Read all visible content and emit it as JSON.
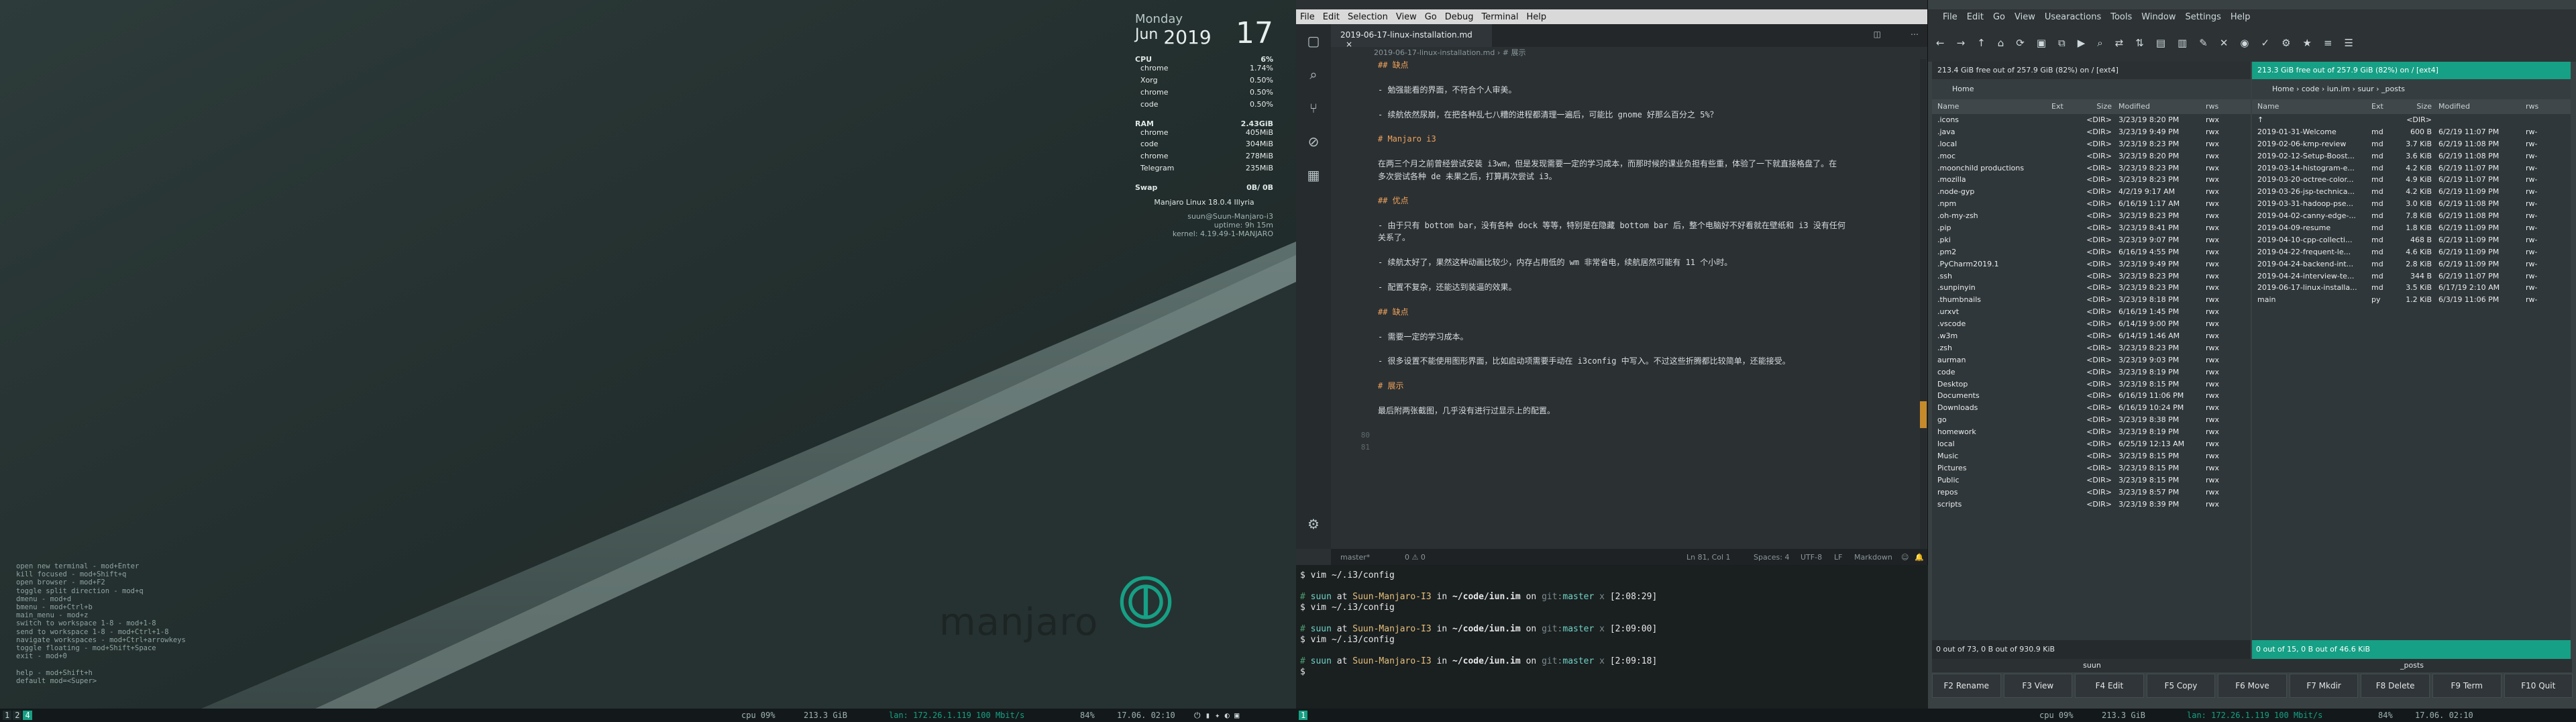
{
  "desktop": {
    "clock": {
      "day_name": "Monday",
      "month": "Jun",
      "year": "2019",
      "day": "17"
    },
    "cpu": {
      "label": "CPU",
      "value": "6%",
      "procs": [
        [
          "chrome",
          "1.74%"
        ],
        [
          "Xorg",
          "0.50%"
        ],
        [
          "chrome",
          "0.50%"
        ],
        [
          "code",
          "0.50%"
        ]
      ]
    },
    "ram": {
      "label": "RAM",
      "value": "2.43GiB",
      "procs": [
        [
          "chrome",
          "405MiB"
        ],
        [
          "code",
          "304MiB"
        ],
        [
          "chrome",
          "278MiB"
        ],
        [
          "Telegram",
          "235MiB"
        ]
      ]
    },
    "swap": {
      "label": "Swap",
      "value": "0B/ 0B"
    },
    "sys": {
      "os": "Manjaro Linux 18.0.4 Illyria",
      "user": "suun@Suun-Manjaro-i3",
      "uptime": "uptime: 9h 15m",
      "kernel": "kernel: 4.19.49-1-MANJARO"
    },
    "logo_text": "manjaro",
    "hints": [
      "open new terminal - mod+Enter",
      "kill focused - mod+Shift+q",
      "open browser - mod+F2",
      "toggle split direction - mod+q",
      "dmenu - mod+d",
      "bmenu - mod+Ctrl+b",
      "main_menu - mod+z",
      "switch to workspace 1-8 - mod+1-8",
      "send to workspace 1-8 - mod+Ctrl+1-8",
      "navigate workspaces - mod+Ctrl+arrowkeys",
      "toggle floating - mod+Shift+Space",
      "exit - mod+0",
      "",
      "help - mod+Shift+h",
      "default mod=<Super>"
    ]
  },
  "statusbar": {
    "ws_left": [
      "1",
      "2",
      "4"
    ],
    "cpu": "cpu  09%",
    "disk": "213.3 GiB",
    "lan": "lan: 172.26.1.119 100 Mbit/s",
    "bat": "84%",
    "datetime": "17.06. 02:10",
    "ws_right": [
      "1"
    ],
    "cpu2": "cpu  09%",
    "disk2": "213.3 GiB",
    "lan2": "lan: 172.26.1.119 100 Mbit/s",
    "bat2": "84%",
    "datetime2": "17.06. 02:10"
  },
  "editor": {
    "menu": [
      "File",
      "Edit",
      "Selection",
      "View",
      "Go",
      "Debug",
      "Terminal",
      "Help"
    ],
    "tab": "2019-06-17-linux-installation.md",
    "breadcrumb": "2019-06-17-linux-installation.md › # 展示",
    "lines": [
      {
        "n": "",
        "t": "## 缺点",
        "k": "h"
      },
      {
        "n": "",
        "t": "",
        "k": "l"
      },
      {
        "n": "",
        "t": "- 勉强能看的界面，不符合个人审美。",
        "k": "l"
      },
      {
        "n": "",
        "t": "",
        "k": "l"
      },
      {
        "n": "",
        "t": "- 续航依然尿崩，在把各种乱七八糟的进程都清理一遍后，可能比 gnome 好那么百分之 5%？",
        "k": "l"
      },
      {
        "n": "",
        "t": "",
        "k": "l"
      },
      {
        "n": "",
        "t": "# Manjaro i3",
        "k": "h"
      },
      {
        "n": "",
        "t": "",
        "k": "l"
      },
      {
        "n": "",
        "t": "在两三个月之前曾经尝试安装 i3wm，但是发现需要一定的学习成本，而那时候的课业负担有些重，体验了一下就直接格盘了。在",
        "k": "l"
      },
      {
        "n": "",
        "t": "多次尝试各种 de 未果之后，打算再次尝试 i3。",
        "k": "l"
      },
      {
        "n": "",
        "t": "",
        "k": "l"
      },
      {
        "n": "",
        "t": "## 优点",
        "k": "h"
      },
      {
        "n": "",
        "t": "",
        "k": "l"
      },
      {
        "n": "",
        "t": "- 由于只有 bottom bar，没有各种 dock 等等，特别是在隐藏 bottom bar 后，整个电脑好不好看就在壁纸和 i3 没有任何",
        "k": "l"
      },
      {
        "n": "",
        "t": "关系了。",
        "k": "l"
      },
      {
        "n": "",
        "t": "",
        "k": "l"
      },
      {
        "n": "",
        "t": "- 续航太好了，果然这种动画比较少，内存占用低的 wm 非常省电，续航居然可能有 11 个小时。",
        "k": "l"
      },
      {
        "n": "",
        "t": "",
        "k": "l"
      },
      {
        "n": "",
        "t": "- 配置不复杂，还能达到装逼的效果。",
        "k": "l"
      },
      {
        "n": "",
        "t": "",
        "k": "l"
      },
      {
        "n": "",
        "t": "## 缺点",
        "k": "h"
      },
      {
        "n": "",
        "t": "",
        "k": "l"
      },
      {
        "n": "",
        "t": "- 需要一定的学习成本。",
        "k": "l"
      },
      {
        "n": "",
        "t": "",
        "k": "l"
      },
      {
        "n": "",
        "t": "- 很多设置不能使用图形界面，比如启动项需要手动在 i3config 中写入。不过这些折腾都比较简单，还能接受。",
        "k": "l"
      },
      {
        "n": "",
        "t": "",
        "k": "l"
      },
      {
        "n": "",
        "t": "# 展示",
        "k": "h"
      },
      {
        "n": "",
        "t": "",
        "k": "l"
      },
      {
        "n": "",
        "t": "最后附两张截图，几乎没有进行过显示上的配置。",
        "k": "l"
      },
      {
        "n": "",
        "t": "",
        "k": "l"
      },
      {
        "n": "80",
        "t": "",
        "k": "l"
      },
      {
        "n": "81",
        "t": "",
        "k": "l"
      }
    ],
    "status": {
      "branch": "master*",
      "errors": "0 ⚠ 0",
      "pos": "Ln 81, Col 1",
      "spaces": "Spaces: 4",
      "enc": "UTF-8",
      "eol": "LF",
      "lang": "Markdown"
    }
  },
  "terminal": {
    "lines": [
      {
        "type": "cmd",
        "text": "$ vim ~/.i3/config"
      },
      {
        "type": "blank"
      },
      {
        "type": "prompt",
        "user": "suun",
        "host": "Suun-Manjaro-I3",
        "dir": "~/code/iun.im",
        "branch": "master",
        "time": "[2:08:29]"
      },
      {
        "type": "cmd",
        "text": "$ vim ~/.i3/config"
      },
      {
        "type": "blank"
      },
      {
        "type": "prompt",
        "user": "suun",
        "host": "Suun-Manjaro-I3",
        "dir": "~/code/iun.im",
        "branch": "master",
        "time": "[2:09:00]"
      },
      {
        "type": "cmd",
        "text": "$ vim ~/.i3/config"
      },
      {
        "type": "blank"
      },
      {
        "type": "prompt",
        "user": "suun",
        "host": "Suun-Manjaro-I3",
        "dir": "~/code/iun.im",
        "branch": "master",
        "time": "[2:09:18]"
      },
      {
        "type": "cmd",
        "text": "$ "
      }
    ]
  },
  "filemanager": {
    "menu": [
      "File",
      "Edit",
      "Go",
      "View",
      "Usearactions",
      "Tools",
      "Window",
      "Settings",
      "Help"
    ],
    "left": {
      "drive": "213.4 GiB free out of 257.9 GiB (82%) on / [ext4]",
      "path": "Home",
      "cols": [
        "Name",
        "Ext",
        "Size",
        "Modified",
        "rws"
      ],
      "rows": [
        [
          ".icons",
          "",
          "<DIR>",
          "3/23/19 8:20 PM",
          "rwx"
        ],
        [
          ".java",
          "",
          "<DIR>",
          "3/23/19 9:49 PM",
          "rwx"
        ],
        [
          ".local",
          "",
          "<DIR>",
          "3/23/19 8:23 PM",
          "rwx"
        ],
        [
          ".moc",
          "",
          "<DIR>",
          "3/23/19 8:20 PM",
          "rwx"
        ],
        [
          ".moonchild productions",
          "",
          "<DIR>",
          "3/23/19 8:23 PM",
          "rwx"
        ],
        [
          ".mozilla",
          "",
          "<DIR>",
          "3/23/19 8:23 PM",
          "rwx"
        ],
        [
          ".node-gyp",
          "",
          "<DIR>",
          "4/2/19 9:17 AM",
          "rwx"
        ],
        [
          ".npm",
          "",
          "<DIR>",
          "6/16/19 1:17 AM",
          "rwx"
        ],
        [
          ".oh-my-zsh",
          "",
          "<DIR>",
          "3/23/19 8:23 PM",
          "rwx"
        ],
        [
          ".pip",
          "",
          "<DIR>",
          "3/23/19 8:41 PM",
          "rwx"
        ],
        [
          ".pki",
          "",
          "<DIR>",
          "3/23/19 9:07 PM",
          "rwx"
        ],
        [
          ".pm2",
          "",
          "<DIR>",
          "6/16/19 4:55 PM",
          "rwx"
        ],
        [
          ".PyCharm2019.1",
          "",
          "<DIR>",
          "3/23/19 9:49 PM",
          "rwx"
        ],
        [
          ".ssh",
          "",
          "<DIR>",
          "3/23/19 8:23 PM",
          "rwx"
        ],
        [
          ".sunpinyin",
          "",
          "<DIR>",
          "3/23/19 8:23 PM",
          "rwx"
        ],
        [
          ".thumbnails",
          "",
          "<DIR>",
          "3/23/19 8:18 PM",
          "rwx"
        ],
        [
          ".urxvt",
          "",
          "<DIR>",
          "6/16/19 1:45 PM",
          "rwx"
        ],
        [
          ".vscode",
          "",
          "<DIR>",
          "6/14/19 9:00 PM",
          "rwx"
        ],
        [
          ".w3m",
          "",
          "<DIR>",
          "6/14/19 1:46 AM",
          "rwx"
        ],
        [
          ".zsh",
          "",
          "<DIR>",
          "3/23/19 8:23 PM",
          "rwx"
        ],
        [
          "aurman",
          "",
          "<DIR>",
          "3/23/19 9:03 PM",
          "rwx"
        ],
        [
          "code",
          "",
          "<DIR>",
          "3/23/19 8:19 PM",
          "rwx"
        ],
        [
          "Desktop",
          "",
          "<DIR>",
          "3/23/19 8:15 PM",
          "rwx"
        ],
        [
          "Documents",
          "",
          "<DIR>",
          "6/16/19 11:06 PM",
          "rwx"
        ],
        [
          "Downloads",
          "",
          "<DIR>",
          "6/16/19 10:24 PM",
          "rwx"
        ],
        [
          "go",
          "",
          "<DIR>",
          "3/23/19 8:38 PM",
          "rwx"
        ],
        [
          "homework",
          "",
          "<DIR>",
          "3/23/19 8:19 PM",
          "rwx"
        ],
        [
          "local",
          "",
          "<DIR>",
          "6/25/19 12:13 AM",
          "rwx"
        ],
        [
          "Music",
          "",
          "<DIR>",
          "3/23/19 8:15 PM",
          "rwx"
        ],
        [
          "Pictures",
          "",
          "<DIR>",
          "3/23/19 8:15 PM",
          "rwx"
        ],
        [
          "Public",
          "",
          "<DIR>",
          "3/23/19 8:15 PM",
          "rwx"
        ],
        [
          "repos",
          "",
          "<DIR>",
          "3/23/19 8:57 PM",
          "rwx"
        ],
        [
          "scripts",
          "",
          "<DIR>",
          "3/23/19 8:39 PM",
          "rwx"
        ]
      ],
      "info": "0 out of 73, 0 B out of 930.9 KiB",
      "tabname": "suun"
    },
    "right": {
      "drive": "213.3 GiB free out of 257.9 GiB (82%) on / [ext4]",
      "path": "Home  ›  code  ›  iun.im  ›  suur  ›  _posts",
      "cols": [
        "Name",
        "Ext",
        "Size",
        "Modified",
        "rws"
      ],
      "rows": [
        [
          "↑",
          "",
          "<DIR>",
          "",
          ""
        ],
        [
          "2019-01-31-Welcome",
          "md",
          "600 B",
          "6/2/19 11:07 PM",
          "rw-"
        ],
        [
          "2019-02-06-kmp-review",
          "md",
          "3.7 KiB",
          "6/2/19 11:08 PM",
          "rw-"
        ],
        [
          "2019-02-12-Setup-Boost...",
          "md",
          "3.6 KiB",
          "6/2/19 11:08 PM",
          "rw-"
        ],
        [
          "2019-03-14-histogram-e...",
          "md",
          "4.2 KiB",
          "6/2/19 11:07 PM",
          "rw-"
        ],
        [
          "2019-03-20-octree-color...",
          "md",
          "4.9 KiB",
          "6/2/19 11:07 PM",
          "rw-"
        ],
        [
          "2019-03-26-jsp-technica...",
          "md",
          "4.2 KiB",
          "6/2/19 11:09 PM",
          "rw-"
        ],
        [
          "2019-03-31-hadoop-pse...",
          "md",
          "3.0 KiB",
          "6/2/19 11:08 PM",
          "rw-"
        ],
        [
          "2019-04-02-canny-edge-...",
          "md",
          "7.8 KiB",
          "6/2/19 11:08 PM",
          "rw-"
        ],
        [
          "2019-04-09-resume",
          "md",
          "1.8 KiB",
          "6/2/19 11:09 PM",
          "rw-"
        ],
        [
          "2019-04-10-cpp-collecti...",
          "md",
          "468 B",
          "6/2/19 11:09 PM",
          "rw-"
        ],
        [
          "2019-04-22-frequent-le...",
          "md",
          "4.6 KiB",
          "6/2/19 11:09 PM",
          "rw-"
        ],
        [
          "2019-04-24-backend-int...",
          "md",
          "2.8 KiB",
          "6/2/19 11:09 PM",
          "rw-"
        ],
        [
          "2019-04-24-interview-te...",
          "md",
          "344 B",
          "6/2/19 11:07 PM",
          "rw-"
        ],
        [
          "2019-06-17-linux-installa...",
          "md",
          "3.5 KiB",
          "6/17/19 2:10 AM",
          "rw-"
        ],
        [
          "main",
          "py",
          "1.2 KiB",
          "6/3/19 11:06 PM",
          "rw-"
        ]
      ],
      "info": "0 out of 15, 0 B out of 46.6 KiB",
      "tabname": "_posts"
    },
    "fkeys": [
      "F2 Rename",
      "F3 View",
      "F4 Edit",
      "F5 Copy",
      "F6 Move",
      "F7 Mkdir",
      "F8 Delete",
      "F9 Term",
      "F10 Quit"
    ]
  }
}
